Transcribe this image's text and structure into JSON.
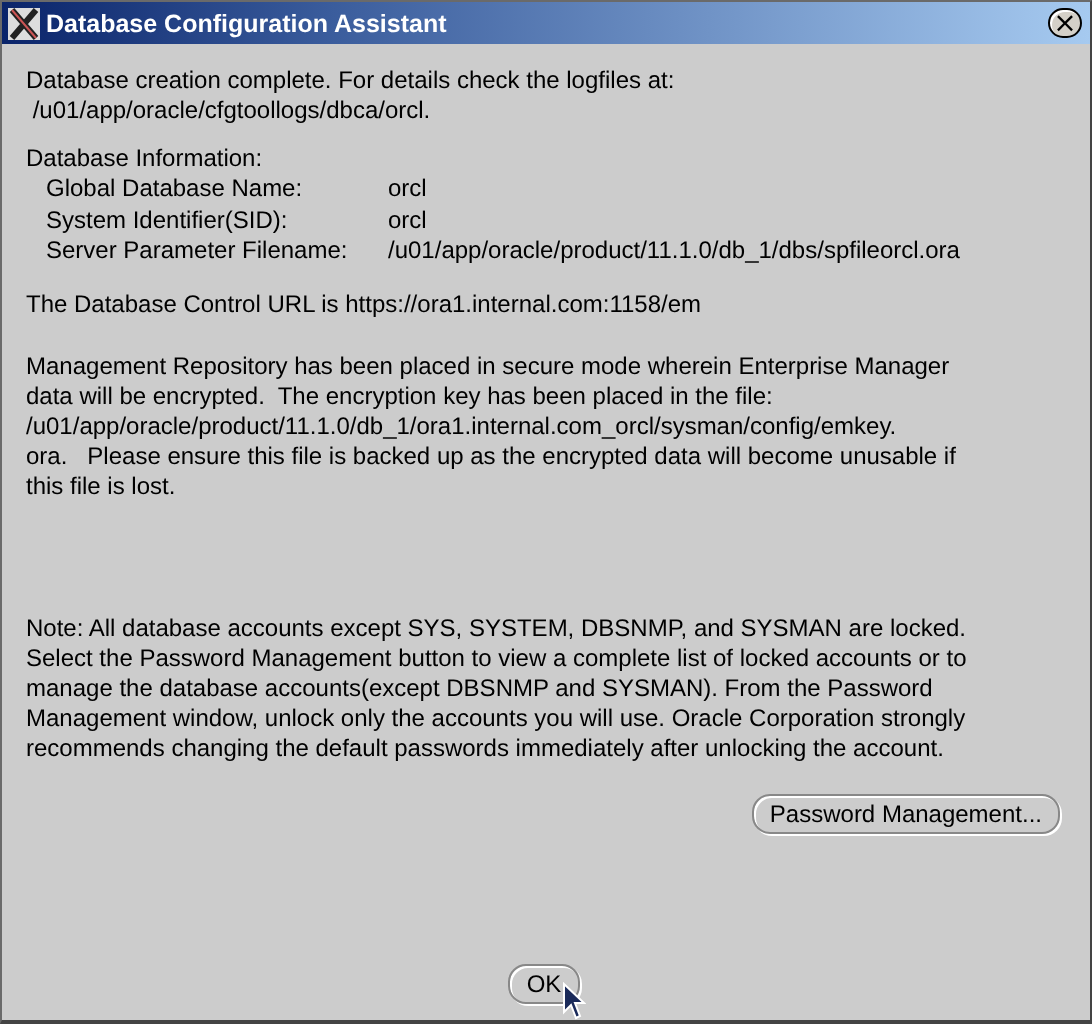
{
  "window": {
    "title": "Database Configuration Assistant",
    "close": "×"
  },
  "intro": "Database creation complete. For details check the logfiles at:\n /u01/app/oracle/cfgtoollogs/dbca/orcl.",
  "info": {
    "heading": "Database Information:",
    "rows": [
      {
        "label": "Global Database Name:",
        "value": "orcl"
      },
      {
        "label": "System Identifier(SID):",
        "value": "orcl"
      },
      {
        "label": "Server Parameter Filename:",
        "value": "/u01/app/oracle/product/11.1.0/db_1/dbs/spfileorcl.ora"
      }
    ]
  },
  "url_text": "The Database Control URL is https://ora1.internal.com:1158/em",
  "repository_text": "Management Repository has been placed in secure mode wherein Enterprise Manager\ndata will be encrypted.  The encryption key has been placed in the file:\n/u01/app/oracle/product/11.1.0/db_1/ora1.internal.com_orcl/sysman/config/emkey.\nora.   Please ensure this file is backed up as the encrypted data will become unusable if\nthis file is lost.",
  "note": "Note: All database accounts except SYS, SYSTEM, DBSNMP, and SYSMAN are locked.\nSelect the Password Management button to view a complete list of locked accounts or to\nmanage the database accounts(except DBSNMP and SYSMAN). From the Password\nManagement window, unlock only the accounts you will use. Oracle Corporation strongly\nrecommends changing the default passwords immediately after unlocking the account.",
  "password_button": "Password Management...",
  "ok_button": "OK"
}
